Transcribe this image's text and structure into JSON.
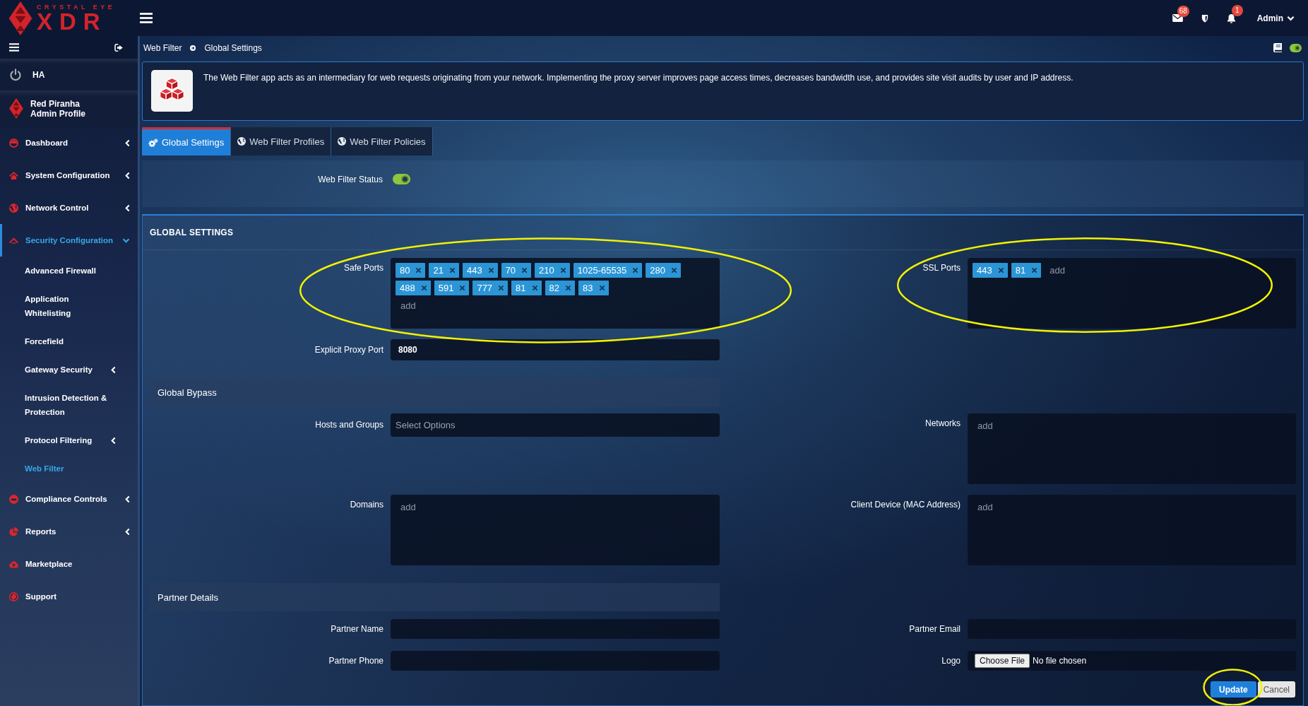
{
  "topbar": {
    "logo": {
      "tagline": "CRYSTAL EYE",
      "wordmark": "XDR"
    },
    "notifications": [
      {
        "kind": "mail",
        "count": "68"
      },
      {
        "kind": "shield"
      },
      {
        "kind": "bell",
        "count": "1"
      }
    ],
    "user": "Admin"
  },
  "sidebar": {
    "ha": {
      "label": "HA"
    },
    "profile": {
      "name": "Red Piranha",
      "role": "Admin Profile"
    },
    "items": [
      {
        "label": "Dashboard",
        "kind": "group",
        "expanded": false,
        "selected": false
      },
      {
        "label": "System Configuration",
        "kind": "group",
        "expanded": false,
        "selected": false
      },
      {
        "label": "Network Control",
        "kind": "group",
        "expanded": false,
        "selected": false
      },
      {
        "label": "Security Configuration",
        "kind": "group",
        "expanded": true,
        "selected": true,
        "children": [
          {
            "label": "Advanced Firewall",
            "kind": "link",
            "selected": false
          },
          {
            "label": "Application Whitelisting",
            "kind": "link",
            "selected": false
          },
          {
            "label": "Forcefield",
            "kind": "link",
            "selected": false
          },
          {
            "label": "Gateway Security",
            "kind": "group",
            "expanded": false,
            "selected": false
          },
          {
            "label": "Intrusion Detection & Protection",
            "kind": "link",
            "selected": false
          },
          {
            "label": "Protocol Filtering",
            "kind": "group",
            "expanded": false,
            "selected": false
          },
          {
            "label": "Web Filter",
            "kind": "link",
            "selected": true
          }
        ]
      },
      {
        "label": "Compliance Controls",
        "kind": "group",
        "expanded": false,
        "selected": false
      },
      {
        "label": "Reports",
        "kind": "group",
        "expanded": false,
        "selected": false
      },
      {
        "label": "Marketplace",
        "kind": "link",
        "selected": false
      },
      {
        "label": "Support",
        "kind": "link",
        "selected": false
      }
    ]
  },
  "breadcrumb": {
    "trail": [
      "Web Filter",
      "Global Settings"
    ],
    "toggle": {
      "on": true
    }
  },
  "app_info": {
    "description": "The Web Filter app acts as an intermediary for web requests originating from your network. Implementing the proxy server improves page access times, decreases bandwidth use, and provides site visit audits by user and IP address."
  },
  "tabs": [
    {
      "label": "Global Settings",
      "selected": true
    },
    {
      "label": "Web Filter Profiles",
      "selected": false
    },
    {
      "label": "Web Filter Policies",
      "selected": false
    }
  ],
  "status": {
    "label": "Web Filter Status",
    "on": true
  },
  "settings": {
    "title": "GLOBAL SETTINGS",
    "safe_ports": {
      "label": "Safe Ports",
      "tags": [
        "80",
        "21",
        "443",
        "70",
        "210",
        "1025-65535",
        "280",
        "488",
        "591",
        "777",
        "81",
        "82",
        "83"
      ],
      "placeholder": "add",
      "highlighted": true
    },
    "ssl_ports": {
      "label": "SSL Ports",
      "tags": [
        "443",
        "81"
      ],
      "placeholder": "add",
      "highlighted": true
    },
    "explicit_proxy_port": {
      "label": "Explicit Proxy Port",
      "value": "8080"
    },
    "global_bypass": {
      "title": "Global Bypass",
      "hosts_and_groups": {
        "label": "Hosts and Groups",
        "placeholder": "Select Options"
      },
      "networks": {
        "label": "Networks",
        "placeholder": "add"
      },
      "domains": {
        "label": "Domains",
        "placeholder": "add"
      },
      "client_devices": {
        "label": "Client Device (MAC Address)",
        "placeholder": "add"
      }
    },
    "partner_details": {
      "title": "Partner Details",
      "partner_name": {
        "label": "Partner Name"
      },
      "partner_email": {
        "label": "Partner Email"
      },
      "partner_phone": {
        "label": "Partner Phone"
      },
      "logo": {
        "label": "Logo",
        "button": "Choose File",
        "status": "No file chosen"
      }
    }
  },
  "actions": [
    {
      "label": "Update",
      "kind": "primary",
      "highlighted": true
    },
    {
      "label": "Cancel",
      "kind": "secondary",
      "highlighted": false
    }
  ]
}
